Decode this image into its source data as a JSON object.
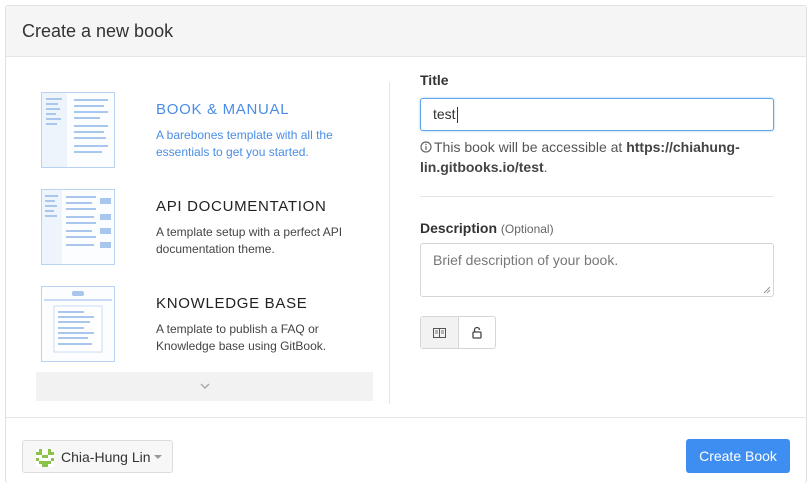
{
  "modal": {
    "title": "Create a new book"
  },
  "templates": [
    {
      "name": "BOOK & MANUAL",
      "description": "A barebones template with all the essentials to get you started.",
      "selected": true
    },
    {
      "name": "API DOCUMENTATION",
      "description": "A template setup with a perfect API documentation theme.",
      "selected": false
    },
    {
      "name": "KNOWLEDGE BASE",
      "description": "A template to publish a FAQ or Knowledge base using GitBook.",
      "selected": false
    }
  ],
  "more_icon": "chevron-down-icon",
  "form": {
    "title_label": "Title",
    "title_value": "test",
    "hint_prefix": "This book will be accessible at ",
    "hint_url": "https://chiahung-lin.gitbooks.io/test",
    "hint_suffix": ".",
    "description_label": "Description",
    "description_optional": "(Optional)",
    "description_placeholder": "Brief description of your book."
  },
  "visibility_buttons": [
    {
      "icon": "book-icon",
      "selected": true
    },
    {
      "icon": "lock-icon",
      "selected": false
    }
  ],
  "footer": {
    "owner_name": "Chia-Hung Lin",
    "create_label": "Create Book"
  },
  "colors": {
    "accent": "#3d8ef0",
    "selected_template_text": "#4a8de6",
    "avatar": "#8bc34a"
  }
}
